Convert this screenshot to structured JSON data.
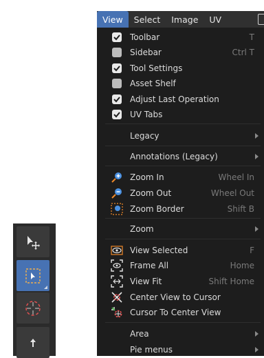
{
  "menubar": {
    "items": [
      "View",
      "Select",
      "Image",
      "UV"
    ]
  },
  "checks": [
    {
      "label": "Toolbar",
      "shortcut": "T",
      "checked": true
    },
    {
      "label": "Sidebar",
      "shortcut": "Ctrl T",
      "checked": false
    },
    {
      "label": "Tool Settings",
      "shortcut": "",
      "checked": true
    },
    {
      "label": "Asset Shelf",
      "shortcut": "",
      "checked": false
    },
    {
      "label": "Adjust Last Operation",
      "shortcut": "",
      "checked": true
    },
    {
      "label": "UV Tabs",
      "shortcut": "",
      "checked": true
    }
  ],
  "submenus": [
    {
      "label": "Legacy"
    },
    {
      "label": "Annotations (Legacy)"
    }
  ],
  "zoom_items": [
    {
      "label": "Zoom In",
      "shortcut": "Wheel In",
      "icon": "zoom-in-icon"
    },
    {
      "label": "Zoom Out",
      "shortcut": "Wheel Out",
      "icon": "zoom-out-icon"
    },
    {
      "label": "Zoom Border",
      "shortcut": "Shift B",
      "icon": "zoom-border-icon"
    }
  ],
  "zoom_submenu": {
    "label": "Zoom"
  },
  "view_items": [
    {
      "label": "View Selected",
      "shortcut": "F",
      "icon": "view-selected-icon"
    },
    {
      "label": "Frame All",
      "shortcut": "Home",
      "icon": "frame-all-icon"
    },
    {
      "label": "View Fit",
      "shortcut": "Shift Home",
      "icon": "view-fit-icon"
    },
    {
      "label": "Center View to Cursor",
      "shortcut": "",
      "icon": "center-to-cursor-icon"
    },
    {
      "label": "Cursor To Center View",
      "shortcut": "",
      "icon": "cursor-to-center-icon"
    }
  ],
  "bottom_submenus": [
    {
      "label": "Area"
    },
    {
      "label": "Pie menus"
    }
  ],
  "colors": {
    "accent": "#4772b3",
    "menu_bg": "#1d1d1d",
    "toolbar_bg": "#2b2b2b"
  }
}
